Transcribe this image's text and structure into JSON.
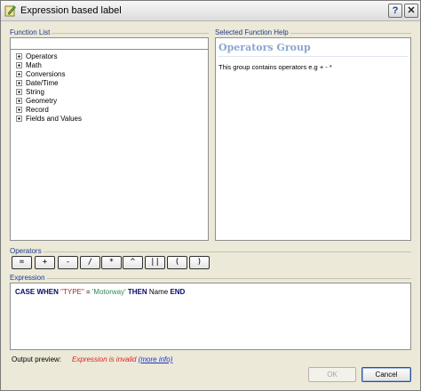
{
  "window": {
    "title": "Expression based label"
  },
  "titlebar": {
    "help_label": "?",
    "close_label": "✕"
  },
  "function_list": {
    "group_label": "Function List",
    "search_value": "",
    "items": [
      {
        "label": "Operators"
      },
      {
        "label": "Math"
      },
      {
        "label": "Conversions"
      },
      {
        "label": "Date/Time"
      },
      {
        "label": "String"
      },
      {
        "label": "Geometry"
      },
      {
        "label": "Record"
      },
      {
        "label": "Fields and Values"
      }
    ]
  },
  "help": {
    "group_label": "Selected Function Help",
    "title": "Operators Group",
    "text": "This group contains operators e.g + - *"
  },
  "operators": {
    "group_label": "Operators",
    "buttons": [
      "=",
      "+",
      "-",
      "/",
      "*",
      "^",
      "||",
      "(",
      ")"
    ]
  },
  "expression": {
    "group_label": "Expression",
    "tokens": {
      "case": "CASE",
      "when": "WHEN",
      "field": "\"TYPE\"",
      "eq": "=",
      "value": "'Motorway'",
      "then": "THEN",
      "name": "Name",
      "end": "END"
    }
  },
  "preview": {
    "label": "Output preview:",
    "message": "Expression is invalid",
    "link": "(more info)"
  },
  "dialog_buttons": {
    "ok": "OK",
    "cancel": "Cancel"
  },
  "colors": {
    "link": "#1f2fd6",
    "error": "#e02020",
    "group_label": "#1f3b8c",
    "help_title": "#8aa7cc"
  }
}
